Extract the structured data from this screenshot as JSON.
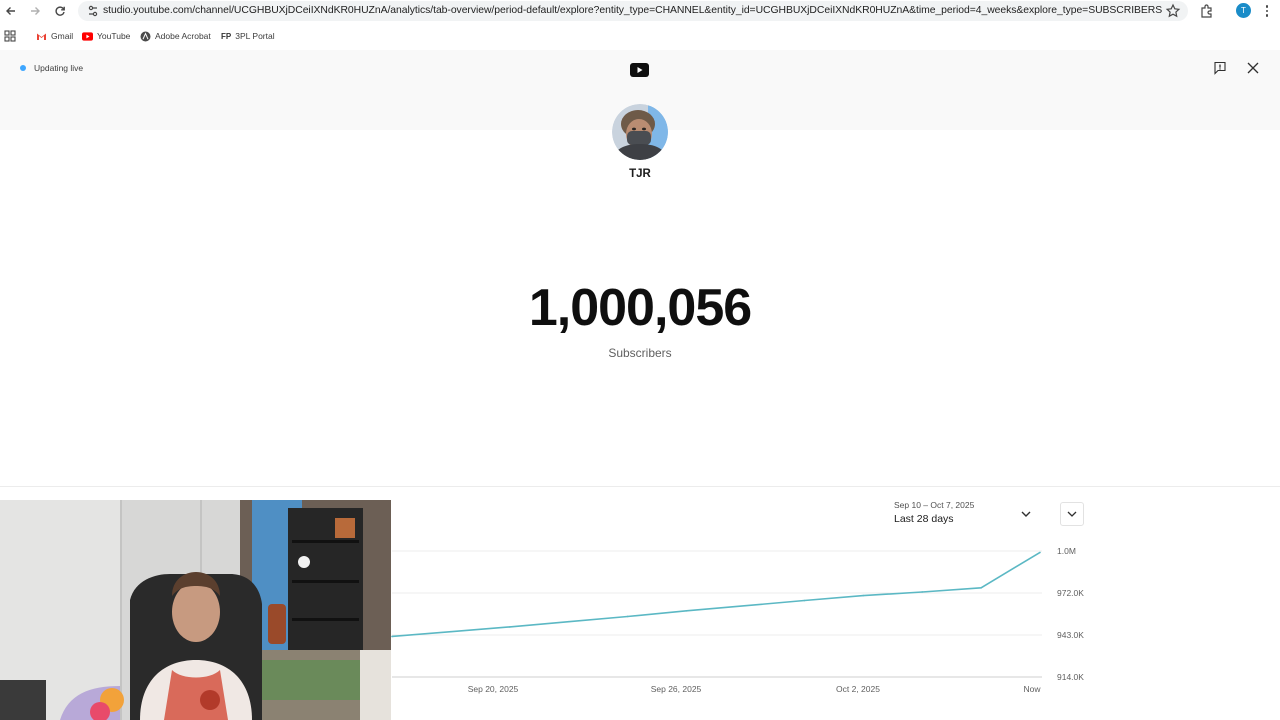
{
  "browser": {
    "url": "studio.youtube.com/channel/UCGHBUXjDCeiIXNdKR0HUZnA/analytics/tab-overview/period-default/explore?entity_type=CHANNEL&entity_id=UCGHBUXjDCeiIXNdKR0HUZnA&time_period=4_weeks&explore_type=SUBSCRIBERS",
    "profile_initial": "T",
    "bookmarks": [
      {
        "label": "Gmail",
        "icon": "gmail-icon"
      },
      {
        "label": "YouTube",
        "icon": "youtube-icon"
      },
      {
        "label": "Adobe Acrobat",
        "icon": "acrobat-icon"
      },
      {
        "label": "3PL Portal",
        "icon": "fp-icon",
        "icon_text": "FP"
      }
    ]
  },
  "studio": {
    "live_status": "Updating live",
    "channel_name": "TJR",
    "subscriber_count": "1,000,056",
    "subscriber_label": "Subscribers",
    "date_range": "Sep 10 – Oct 7, 2025",
    "period_label": "Last 28 days"
  },
  "colors": {
    "accent": "#3ea6ff",
    "line": "#5bb8c4",
    "youtube_red": "#ff0000"
  },
  "chart_data": {
    "type": "line",
    "x_ticks": [
      "Sep 20, 2025",
      "Sep 26, 2025",
      "Oct 2, 2025",
      "Now"
    ],
    "y_ticks": [
      "1.0M",
      "972.0K",
      "943.0K",
      "914.0K"
    ],
    "ylim": [
      914000,
      1001000
    ],
    "series": [
      {
        "x": [
          "Sep 16, 2025",
          "Sep 18, 2025",
          "Sep 20, 2025",
          "Sep 22, 2025",
          "Sep 24, 2025",
          "Sep 26, 2025",
          "Sep 28, 2025",
          "Sep 30, 2025",
          "Oct 2, 2025",
          "Oct 4, 2025",
          "Oct 6, 2025",
          "Now"
        ],
        "values": [
          942000,
          945300,
          948600,
          952200,
          955800,
          959700,
          963200,
          966800,
          970200,
          972700,
          975600,
          1000056
        ]
      }
    ]
  }
}
